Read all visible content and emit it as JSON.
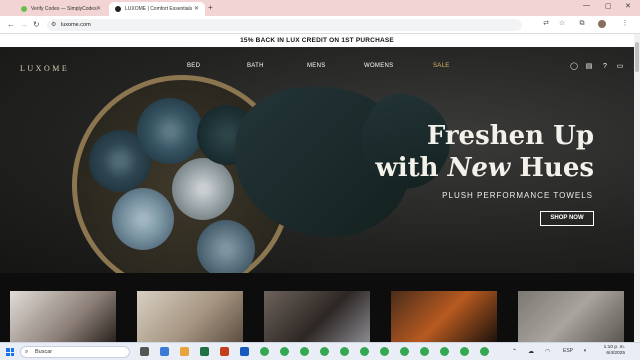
{
  "browser": {
    "tabs": [
      {
        "title": "Verify Codes — SimplyCodes",
        "active": false
      },
      {
        "title": "LUXOME | Comfort Essentials",
        "active": true
      }
    ],
    "url": "luxome.com",
    "window_controls": [
      "minimize",
      "maximize",
      "close"
    ]
  },
  "page": {
    "promo": "15% BACK IN LUX CREDIT ON 1ST PURCHASE",
    "logo": "LUXOME",
    "nav": [
      "BED",
      "BATH",
      "MENS",
      "WOMENS",
      "SALE"
    ],
    "header_icons": [
      "account-icon",
      "rewards-icon",
      "help-icon",
      "cart-icon"
    ],
    "hero": {
      "headline_line1": "Freshen Up",
      "headline_line2_pre": "with ",
      "headline_line2_em": "New",
      "headline_line2_post": " Hues",
      "subheadline": "PLUSH PERFORMANCE TOWELS",
      "cta": "SHOP NOW"
    },
    "accent_colors": {
      "sale": "#e0b56a",
      "logo": "#d6cdb5"
    }
  },
  "taskbar": {
    "search_placeholder": "Buscar",
    "clock_time": "1:10 p. m.",
    "clock_date": "6/4/2025",
    "language": "ESP"
  }
}
